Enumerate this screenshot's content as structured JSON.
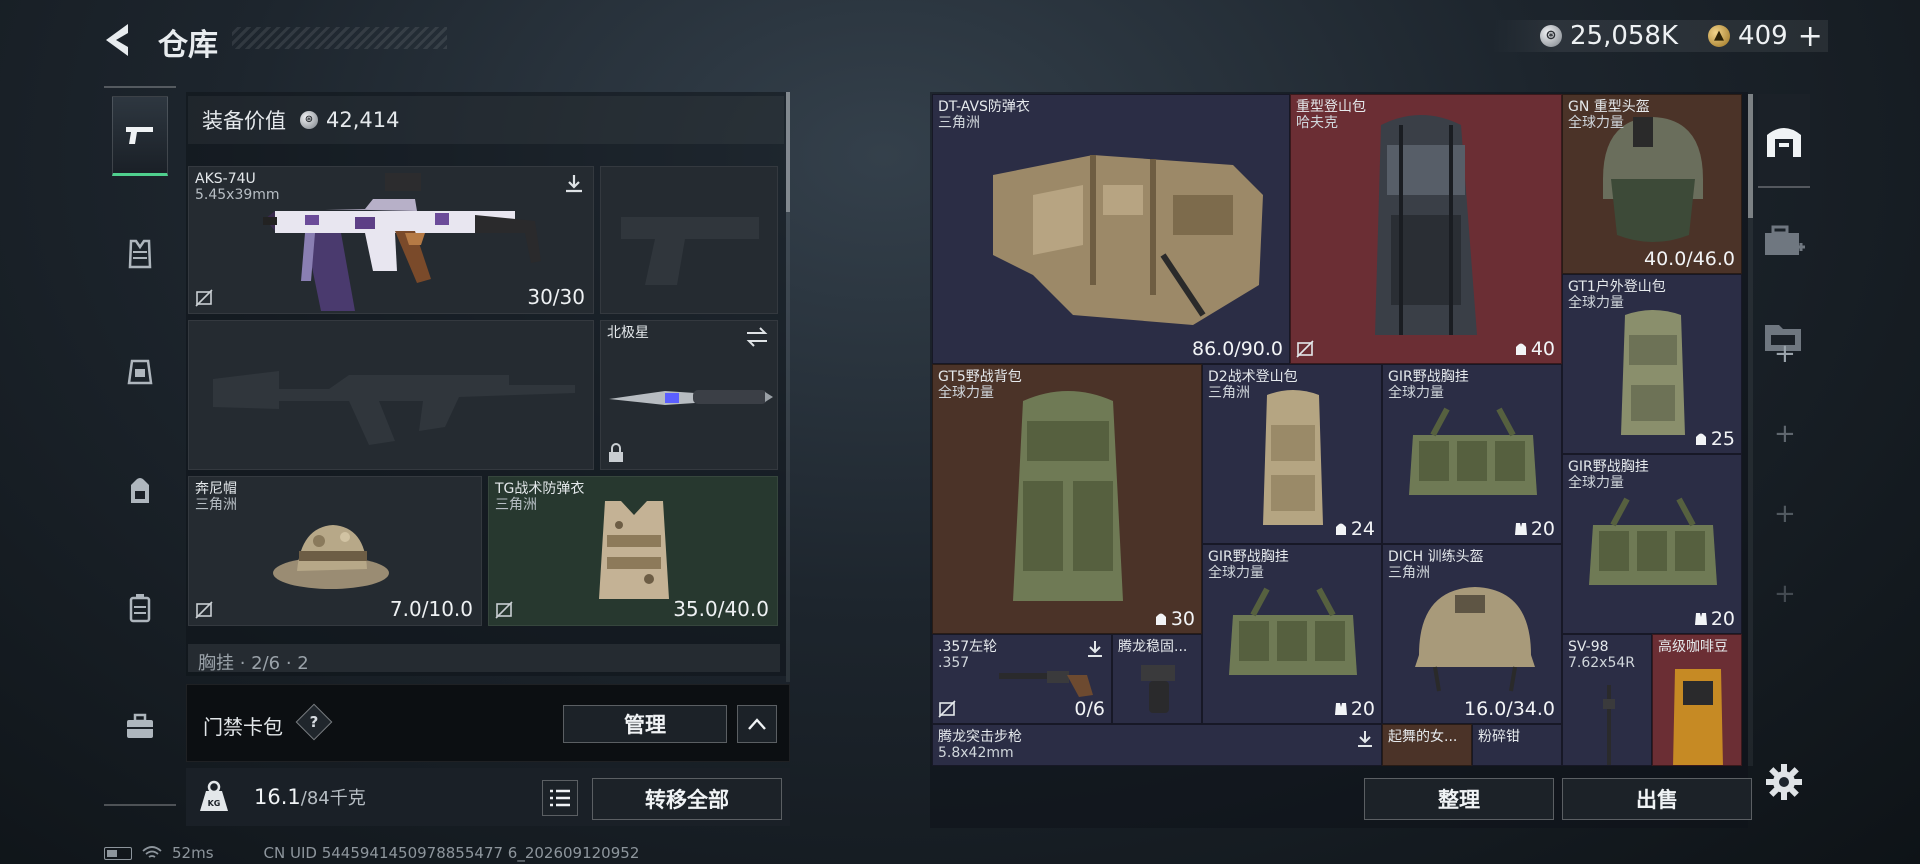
{
  "header": {
    "title": "仓库",
    "silver_amount": "25,058K",
    "gold_amount": "409",
    "gold_add": "+"
  },
  "sidebar": {
    "items": [
      {
        "icon": "pistol-icon",
        "active": true
      },
      {
        "icon": "vest-icon"
      },
      {
        "icon": "rig-icon"
      },
      {
        "icon": "backpack-icon"
      },
      {
        "icon": "case-icon"
      },
      {
        "icon": "toolbox-icon"
      }
    ]
  },
  "loadout": {
    "equip_value_label": "装备价值",
    "equip_value": "42,414",
    "primary_weapon": {
      "name": "AKS-74U",
      "caliber": "5.45x39mm",
      "ammo": "30/30"
    },
    "melee": {
      "name": "北极星"
    },
    "helmet": {
      "name": "奔尼帽",
      "maker": "三角洲",
      "durability": "7.0/10.0"
    },
    "armor": {
      "name": "TG战术防弹衣",
      "maker": "三角洲",
      "durability": "35.0/40.0"
    },
    "chest_rig_row": "胸挂 · 2/6 · 2",
    "card_pack": {
      "label": "门禁卡包",
      "help": "?",
      "manage": "管理",
      "collapse": "^"
    },
    "weight": {
      "current": "16.1",
      "capacity": "/84千克"
    },
    "transfer_all": "转移全部"
  },
  "status": {
    "ping": "52ms",
    "uid": "CN UID 5445941450978855477 6_202609120952"
  },
  "stash": {
    "items": [
      {
        "name": "DT-AVS防弹衣",
        "maker": "三角洲",
        "value": "86.0/90.0"
      },
      {
        "name": "重型登山包",
        "maker": "哈夫克",
        "value": "40"
      },
      {
        "name": "GN 重型头盔",
        "maker": "全球力量",
        "value": "40.0/46.0"
      },
      {
        "name": "GT1户外登山包",
        "maker": "全球力量",
        "value": "25"
      },
      {
        "name": "GT5野战背包",
        "maker": "全球力量",
        "value": "30"
      },
      {
        "name": "D2战术登山包",
        "maker": "三角洲",
        "value": "24"
      },
      {
        "name": "GIR野战胸挂",
        "maker": "全球力量",
        "value": "20"
      },
      {
        "name": "GIR野战胸挂",
        "maker": "全球力量",
        "value": "20"
      },
      {
        "name": "GIR野战胸挂",
        "maker": "全球力量",
        "value": "20"
      },
      {
        "name": "DICH 训练头盔",
        "maker": "三角洲",
        "value": "16.0/34.0"
      },
      {
        "name": ".357左轮",
        "caliber": ".357",
        "value": "0/6"
      },
      {
        "name": "腾龙稳固..."
      },
      {
        "name": "SV-98",
        "caliber": "7.62x54R"
      },
      {
        "name": "高级咖啡豆"
      },
      {
        "name": "腾龙突击步枪",
        "caliber": "5.8x42mm"
      },
      {
        "name": "起舞的女..."
      },
      {
        "name": "粉碎钳"
      }
    ],
    "sort_button": "整理",
    "sell_button": "出售"
  },
  "colors": {
    "accent_green": "#4fd08e",
    "item_red": "#6b2e34",
    "item_brown": "#4b3328",
    "item_purple": "#2b2d45"
  }
}
